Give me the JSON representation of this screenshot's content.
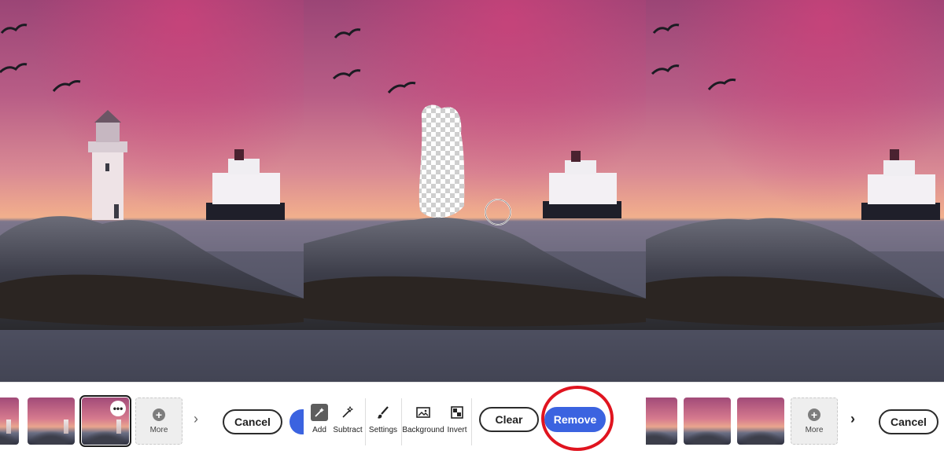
{
  "left_panel": {
    "toolbar": {
      "more_label": "More",
      "cancel_label": "Cancel",
      "more_options_glyph": "•••",
      "next_glyph": "›"
    }
  },
  "middle_panel": {
    "tools": [
      {
        "label": "Add",
        "icon": "magic-brush-add-icon",
        "active": true
      },
      {
        "label": "Subtract",
        "icon": "magic-brush-subtract-icon",
        "active": false
      },
      {
        "label": "Settings",
        "icon": "brush-icon",
        "active": false
      },
      {
        "label": "Background",
        "icon": "image-icon",
        "active": false
      },
      {
        "label": "Invert",
        "icon": "invert-icon",
        "active": false
      }
    ],
    "clear_label": "Clear",
    "remove_label": "Remove"
  },
  "right_panel": {
    "toolbar": {
      "more_label": "More",
      "cancel_label": "Cancel",
      "next_glyph": "›"
    }
  },
  "colors": {
    "accent": "#3b63e0",
    "highlight_ring": "#e0141f",
    "sky_top": "#a24a7a",
    "sky_horizon": "#e9a58e"
  }
}
